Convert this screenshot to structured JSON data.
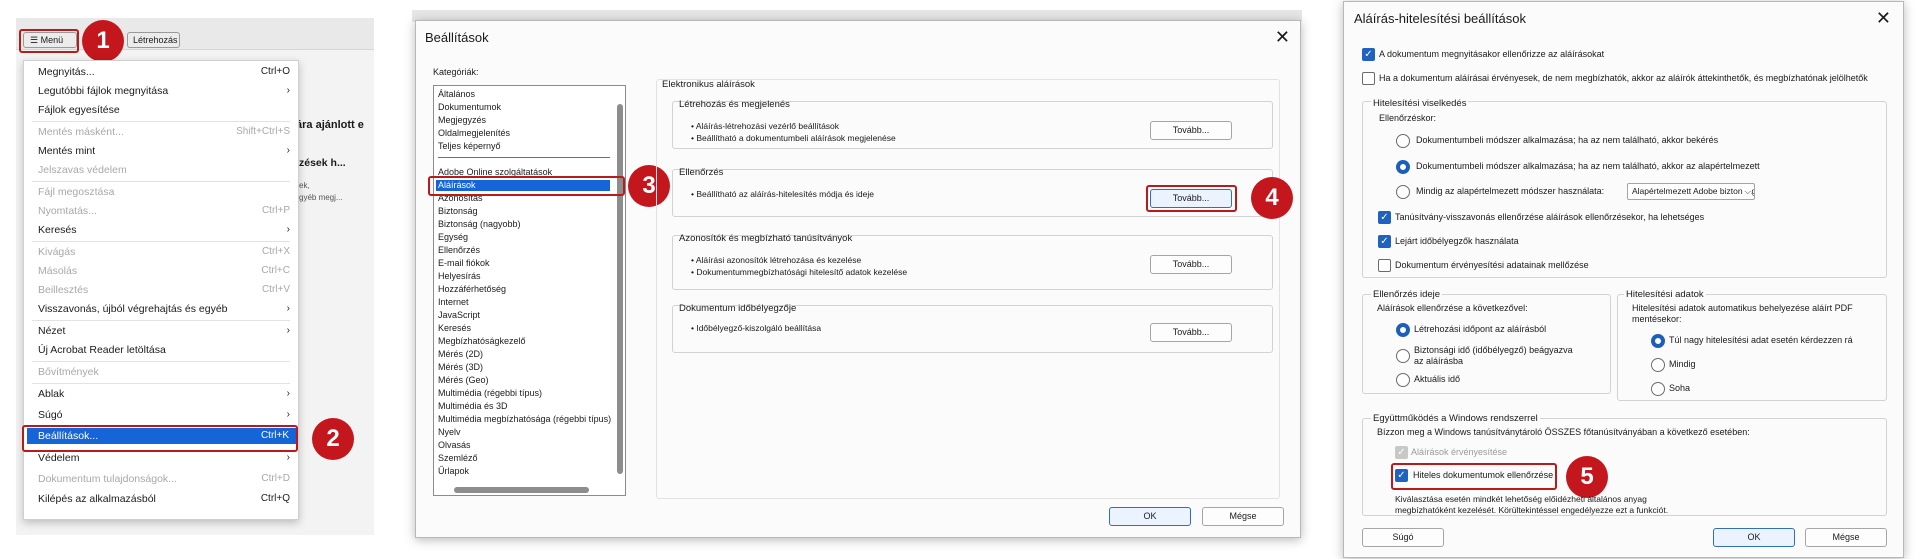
{
  "panel1": {
    "menu_button": "Menü",
    "create_button": "Létrehozás",
    "bg_text_1": "ára ajánlott e",
    "bg_text_2": "zések h...",
    "bg_text_3": "ek,",
    "bg_text_4": "gyéb megj...",
    "menu_items": [
      {
        "label": "Megnyitás...",
        "shortcut": "Ctrl+O"
      },
      {
        "label": "Legutóbbi fájlok megnyitása",
        "shortcut": "›"
      },
      {
        "label": "Fájlok egyesítése",
        "shortcut": ""
      },
      {
        "label": "Mentés másként...",
        "shortcut": "Shift+Ctrl+S"
      },
      {
        "label": "Mentés mint",
        "shortcut": "›"
      },
      {
        "label": "Jelszavas védelem",
        "shortcut": ""
      },
      {
        "label": "Fájl megosztása",
        "shortcut": ""
      },
      {
        "label": "Nyomtatás...",
        "shortcut": "Ctrl+P"
      },
      {
        "label": "Keresés",
        "shortcut": "›"
      },
      {
        "label": "Kivágás",
        "shortcut": "Ctrl+X"
      },
      {
        "label": "Másolás",
        "shortcut": "Ctrl+C"
      },
      {
        "label": "Beillesztés",
        "shortcut": "Ctrl+V"
      },
      {
        "label": "Visszavonás, újból végrehajtás és egyéb",
        "shortcut": "›"
      },
      {
        "label": "Nézet",
        "shortcut": "›"
      },
      {
        "label": "Új Acrobat Reader letöltása",
        "shortcut": ""
      },
      {
        "label": "Bővítmények",
        "shortcut": ""
      },
      {
        "label": "Ablak",
        "shortcut": "›"
      },
      {
        "label": "Súgó",
        "shortcut": "›"
      },
      {
        "label": "Beállítások...",
        "shortcut": "Ctrl+K"
      },
      {
        "label": "Védelem",
        "shortcut": "›"
      },
      {
        "label": "Dokumentum tulajdonságok...",
        "shortcut": "Ctrl+D"
      },
      {
        "label": "Kilépés az alkalmazásból",
        "shortcut": "Ctrl+Q"
      }
    ]
  },
  "panel2": {
    "title": "Beállítások",
    "categories_label": "Kategóriák:",
    "categories": [
      "Általános",
      "Dokumentumok",
      "Megjegyzés",
      "Oldalmegjelenítés",
      "Teljes képernyő",
      "Adobe Online szolgáltatások",
      "Aláírások",
      "Azonosítás",
      "Biztonság",
      "Biztonság (nagyobb)",
      "Egység",
      "Ellenőrzés",
      "E-mail fiókok",
      "Helyesírás",
      "Hozzáférhetőség",
      "Internet",
      "JavaScript",
      "Keresés",
      "Megbízhatóságkezelő",
      "Mérés (2D)",
      "Mérés (3D)",
      "Mérés (Geo)",
      "Multimédia (régebbi típus)",
      "Multimédia és 3D",
      "Multimédia megbízhatósága (régebbi típus)",
      "Nyelv",
      "Olvasás",
      "Szemléző",
      "Űrlapok"
    ],
    "section_title": "Elektronikus aláírások",
    "groups": [
      {
        "title": "Létrehozás és megjelenés",
        "lines": [
          "• Aláírás-létrehozási vezérlő beállítások",
          "• Beállítható a dokumentumbeli aláírások megjelenése"
        ],
        "button": "Tovább..."
      },
      {
        "title": "Ellenőrzés",
        "lines": [
          "• Beállítható az aláírás-hitelesítés módja és ideje"
        ],
        "button": "Tovább..."
      },
      {
        "title": "Azonosítók és megbízható tanúsítványok",
        "lines": [
          "• Aláírási azonosítók létrehozása és kezelése",
          "• Dokumentummegbízhatósági hitelesítő adatok kezelése"
        ],
        "button": "Tovább..."
      },
      {
        "title": "Dokumentum időbélyegzője",
        "lines": [
          "• Időbélyegző-kiszolgáló beállítása"
        ],
        "button": "Tovább..."
      }
    ],
    "ok": "OK",
    "cancel": "Mégse"
  },
  "panel3": {
    "title": "Aláírás-hitelesítési beállítások",
    "top_checks": [
      {
        "label": "A dokumentum megnyitásakor ellenőrizze az aláírásokat",
        "checked": true
      },
      {
        "label": "Ha a dokumentum aláírásai érvényesek, de nem megbízhatók, akkor az aláírók áttekinthetők, és megbízhatónak jelölhetők",
        "checked": false
      }
    ],
    "behavior_title": "Hitelesítési viselkedés",
    "verify_label": "Ellenőrzéskor:",
    "radios": [
      {
        "label": "Dokumentumbeli módszer alkalmazása; ha az nem található, akkor bekérés",
        "on": false
      },
      {
        "label": "Dokumentumbeli módszer alkalmazása; ha az nem található, akkor az alapértelmezett",
        "on": true
      },
      {
        "label": "Mindig az alapértelmezett módszer használata:",
        "on": false
      }
    ],
    "default_method": "Alapértelmezett Adobe biztonság",
    "behavior_checks": [
      {
        "label": "Tanúsítvány-visszavonás ellenőrzése aláírások ellenőrzésekor, ha lehetséges",
        "checked": true
      },
      {
        "label": "Lejárt időbélyegzők használata",
        "checked": true
      },
      {
        "label": "Dokumentum érvényesítési adatainak mellőzése",
        "checked": false
      }
    ],
    "time_title": "Ellenőrzés ideje",
    "time_desc": "Aláírások ellenőrzése a következővel:",
    "time_radios": [
      {
        "label": "Létrehozási időpont az aláírásból",
        "on": true
      },
      {
        "label": "Biztonsági idő (időbélyegző) beágyazva",
        "label2": "az aláírásba",
        "on": false
      },
      {
        "label": "Aktuális idő",
        "on": false
      }
    ],
    "data_title": "Hitelesítési adatok",
    "data_desc1": "Hitelesítési adatok automatikus behelyezése aláírt PDF",
    "data_desc2": "mentésekor:",
    "data_radios": [
      {
        "label": "Túl nagy hitelesítési adat esetén kérdezzen rá",
        "on": true
      },
      {
        "label": "Mindig",
        "on": false
      },
      {
        "label": "Soha",
        "on": false
      }
    ],
    "windows_title": "Együttműködés a Windows rendszerrel",
    "windows_desc": "Bízzon meg a Windows tanúsítványtároló ÖSSZES főtanúsítványában a következő esetében:",
    "windows_checks": [
      {
        "label": "Aláírások érvényesítése",
        "checked": true,
        "disabled": true
      },
      {
        "label": "Hiteles dokumentumok ellenőrzése",
        "checked": true,
        "disabled": false
      }
    ],
    "note1": "Kiválasztása esetén mindkét lehetőség előidézheti általános anyag",
    "note2": "megbízhatóként kezelését. Körültekintéssel engedélyezze ezt a funkciót.",
    "help": "Súgó",
    "ok": "OK",
    "cancel": "Mégse"
  },
  "steps": [
    "1",
    "2",
    "3",
    "4",
    "5"
  ]
}
